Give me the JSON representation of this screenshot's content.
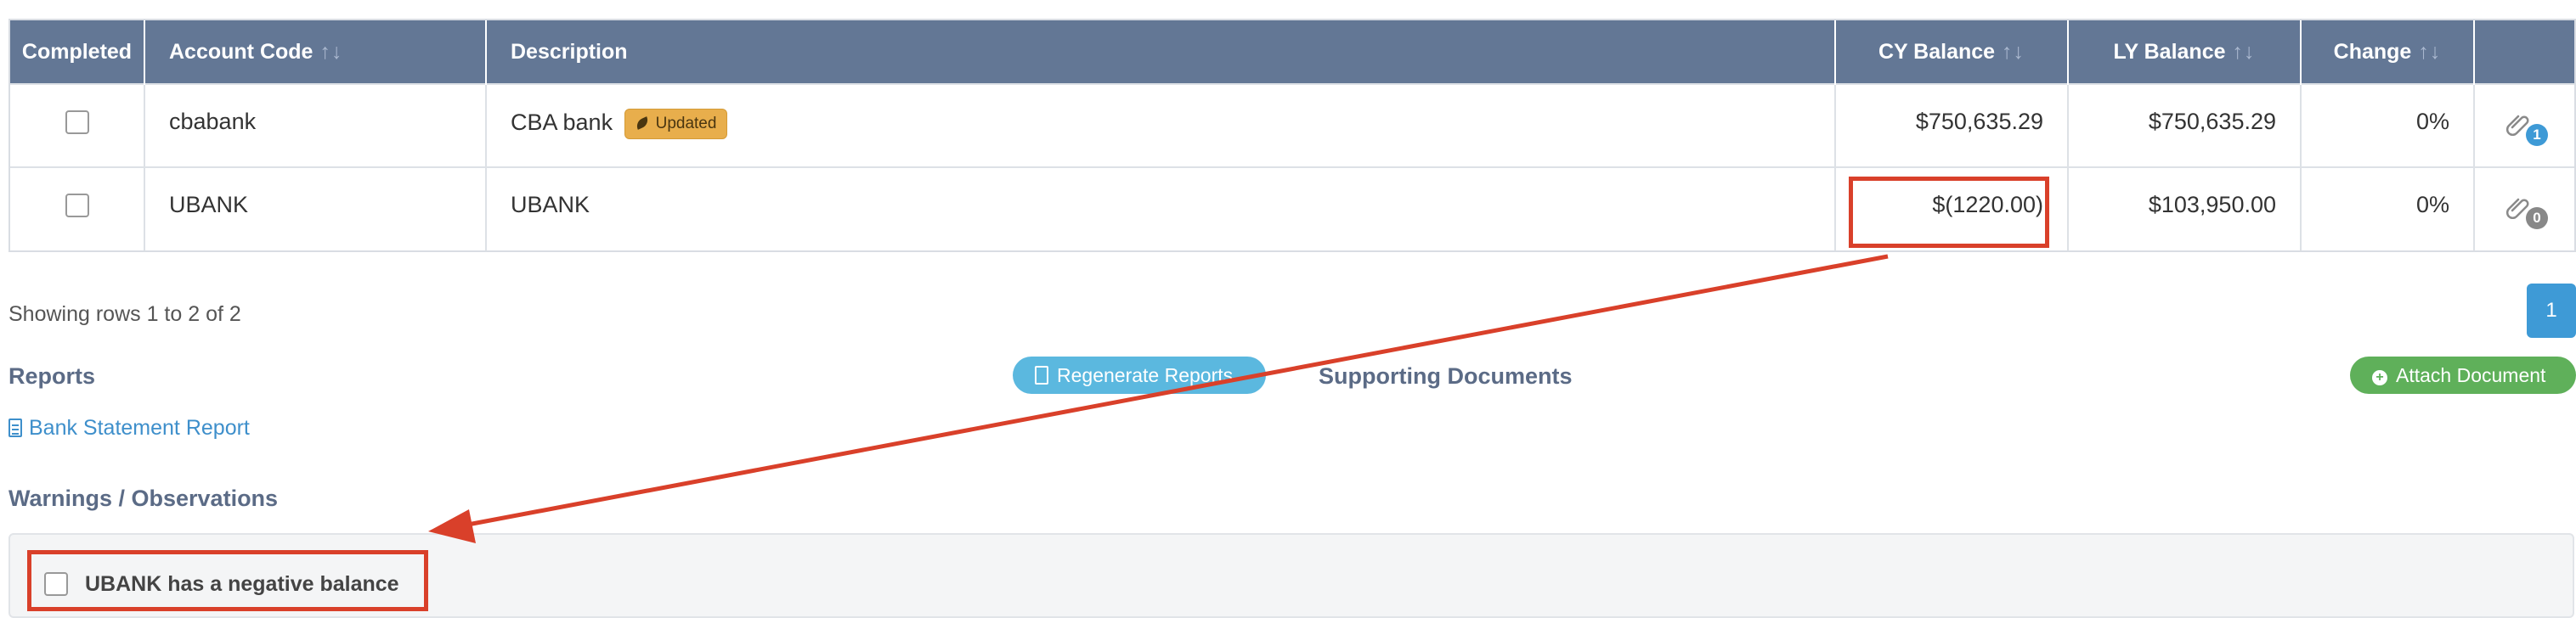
{
  "table": {
    "columns": [
      {
        "label": "Completed",
        "sortable": false
      },
      {
        "label": "Account Code",
        "sortable": true
      },
      {
        "label": "Description",
        "sortable": false
      },
      {
        "label": "CY Balance",
        "sortable": true
      },
      {
        "label": "LY Balance",
        "sortable": true
      },
      {
        "label": "Change",
        "sortable": true
      },
      {
        "label": "",
        "sortable": false
      }
    ],
    "sort_glyph": "↑↓",
    "rows": [
      {
        "completed": false,
        "account_code": "cbabank",
        "description": "CBA bank",
        "badge": "Updated",
        "cy_balance": "$750,635.29",
        "ly_balance": "$750,635.29",
        "change": "0%",
        "attachments": "1"
      },
      {
        "completed": false,
        "account_code": "UBANK",
        "description": "UBANK",
        "badge": "",
        "cy_balance": "$(1220.00)",
        "ly_balance": "$103,950.00",
        "change": "0%",
        "attachments": "0"
      }
    ]
  },
  "pagination": {
    "info": "Showing rows 1 to 2 of 2",
    "current_page": "1"
  },
  "reports": {
    "title": "Reports",
    "regenerate_label": "Regenerate Reports",
    "items": [
      "Bank Statement Report"
    ]
  },
  "supporting_documents": {
    "title": "Supporting Documents",
    "attach_label": "Attach Document"
  },
  "warnings": {
    "title": "Warnings / Observations",
    "items": [
      {
        "label": "UBANK has a negative balance",
        "checked": false
      }
    ]
  },
  "colors": {
    "header_bg": "#637795",
    "annotation": "#d9402a",
    "badge": "#e8ae4c",
    "primary": "#3e9ad6",
    "success": "#5fb05a"
  }
}
